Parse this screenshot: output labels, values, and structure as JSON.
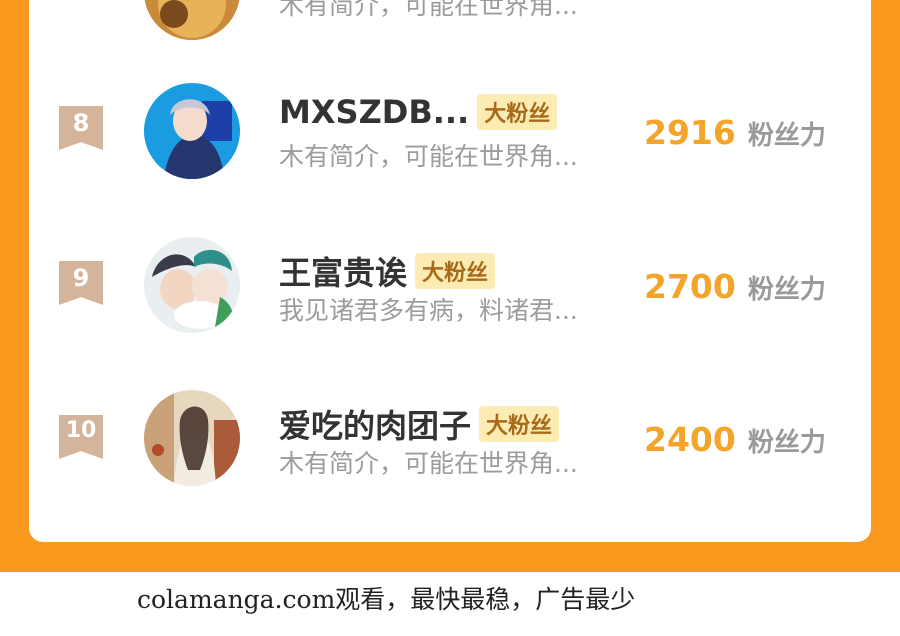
{
  "badge_label": "大粉丝",
  "score_unit": "粉丝力",
  "top_partial_row": {
    "bio": "木有简介，可能在世界角..."
  },
  "rows": [
    {
      "rank": "8",
      "name": "MXSZDB...",
      "bio": "木有简介，可能在世界角...",
      "score": "2916"
    },
    {
      "rank": "9",
      "name": "王富贵诶",
      "bio": "我见诸君多有病，料诸君...",
      "score": "2700"
    },
    {
      "rank": "10",
      "name": "爱吃的肉团子",
      "bio": "木有简介，可能在世界角...",
      "score": "2400"
    }
  ],
  "watermark": "colamanga.com观看，最快最稳，广告最少",
  "colors": {
    "frame": "#f99a1f",
    "score": "#f5a42a",
    "badge_bg": "#fcecb4",
    "rank_ribbon": "#d4b49a"
  }
}
